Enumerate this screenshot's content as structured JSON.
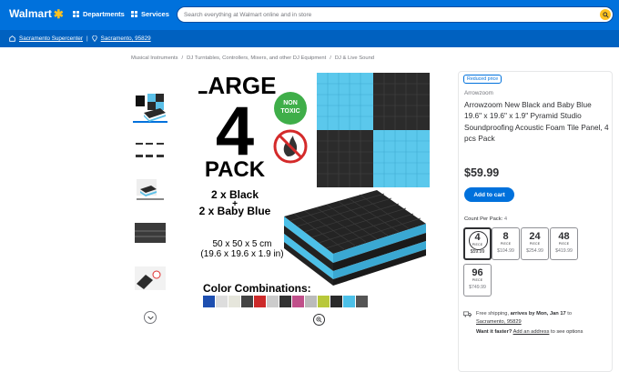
{
  "header": {
    "logo_text": "Walmart",
    "departments_label": "Departments",
    "services_label": "Services",
    "search_placeholder": "Search everything at Walmart online and in store",
    "brand_color": "#0071dc",
    "accent_color": "#ffc220"
  },
  "subheader": {
    "store": "Sacramento Supercenter",
    "separator": "|",
    "zip": "Sacramento, 95829"
  },
  "breadcrumb": [
    "Musical Instruments",
    "DJ Turntables, Controllers, Mixers, and other DJ Equipment",
    "DJ & Live Sound"
  ],
  "breadcrumb_sep": "/",
  "product_image": {
    "large_text": "LARGE",
    "number_text": "4",
    "pack_text": "PACK",
    "non_toxic_line1": "NON",
    "non_toxic_line2": "TOXIC",
    "black_count": "2 x Black",
    "plus": "+",
    "blue_count": "2 x Baby Blue",
    "size_cm": "50 x 50 x 5 cm",
    "size_in": "(19.6 x 19.6 x 1.9 in)",
    "combos_label": "Color Combinations:"
  },
  "product": {
    "badge": "Reduced price",
    "brand": "Arrowzoom",
    "title": "Arrowzoom New Black and Baby Blue 19.6\" x 19.6\" x 1.9\" Pyramid Studio Soundproofing Acoustic Foam Tile Panel, 4 pcs Pack",
    "price": "$59.99",
    "add_to_cart": "Add to cart",
    "count_label": "Count Per Pack:",
    "count_value": "4",
    "options": [
      {
        "count": "4",
        "unit": "PIECE",
        "price": "$59.99",
        "selected": true
      },
      {
        "count": "8",
        "unit": "PIECE",
        "price": "$104.99",
        "selected": false
      },
      {
        "count": "24",
        "unit": "PIECE",
        "price": "$254.99",
        "selected": false
      },
      {
        "count": "48",
        "unit": "PIECE",
        "price": "$419.99",
        "selected": false
      },
      {
        "count": "96",
        "unit": "PIECE",
        "price": "$749.99",
        "selected": false
      }
    ]
  },
  "shipping": {
    "free_shipping": "Free shipping,",
    "arrives": "arrives by Mon, Jan 17",
    "to": "to",
    "location": "Sacramento, 95829",
    "want_faster": "Want it faster?",
    "add_address": "Add an address",
    "see_options": "to see options"
  }
}
